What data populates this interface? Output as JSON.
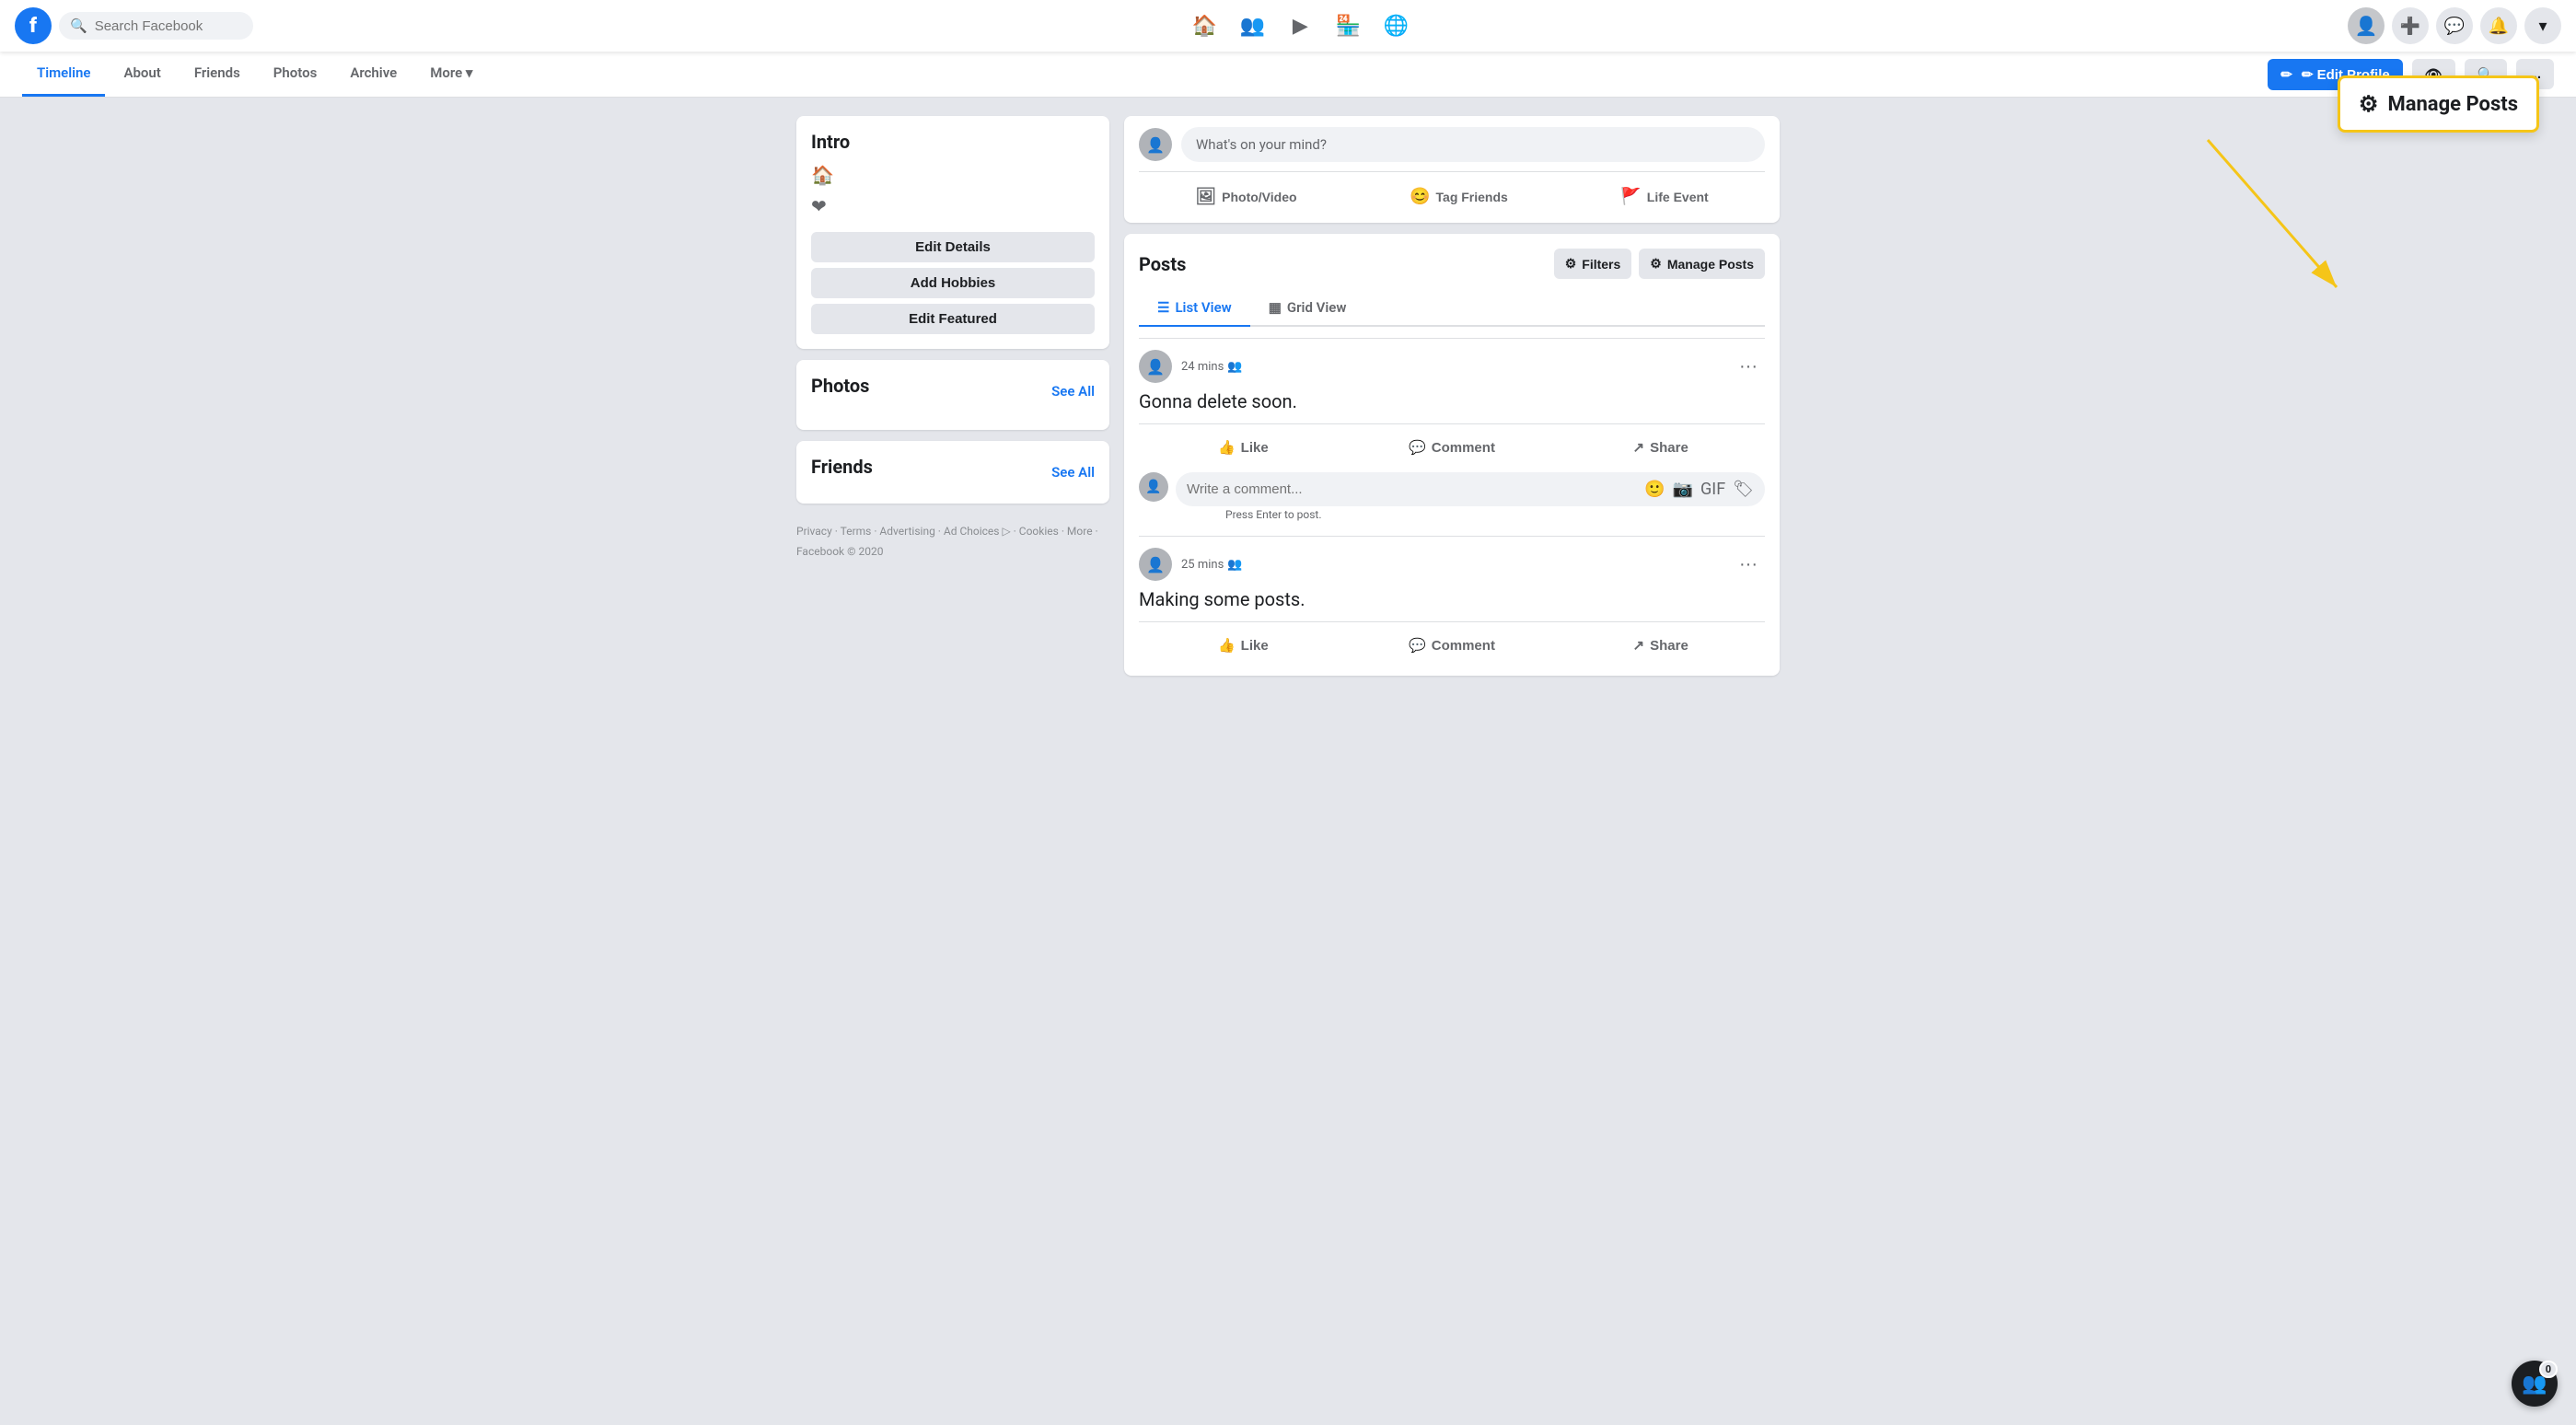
{
  "topnav": {
    "search_placeholder": "Search Facebook",
    "nav_icons": [
      "🏠",
      "👥",
      "▶",
      "🏪",
      "🌐"
    ],
    "add_label": "+",
    "messenger_label": "💬",
    "bell_label": "🔔",
    "dropdown_label": "▾"
  },
  "profile_tabs": {
    "tabs": [
      {
        "label": "Timeline",
        "active": true
      },
      {
        "label": "About",
        "active": false
      },
      {
        "label": "Friends",
        "active": false
      },
      {
        "label": "Photos",
        "active": false
      },
      {
        "label": "Archive",
        "active": false
      },
      {
        "label": "More ▾",
        "active": false
      }
    ],
    "edit_profile": "✏ Edit Profile",
    "eye_label": "👁",
    "search_label": "🔍",
    "more_label": "..."
  },
  "intro": {
    "title": "Intro",
    "home_icon": "🏠",
    "heart_icon": "❤",
    "edit_details": "Edit Details",
    "add_hobbies": "Add Hobbies",
    "edit_featured": "Edit Featured"
  },
  "photos": {
    "title": "Photos",
    "see_all": "See All"
  },
  "friends": {
    "title": "Friends",
    "see_all": "See All"
  },
  "footer": {
    "links": "Privacy · Terms · Advertising · Ad Choices ▷ · Cookies · More · Facebook © 2020"
  },
  "composer": {
    "placeholder": "What's on your mind?",
    "photo_video": "Photo/Video",
    "tag_friends": "Tag Friends",
    "life_event": "Life Event"
  },
  "posts_section": {
    "title": "Posts",
    "filters_label": "Filters",
    "manage_posts_label": "Manage Posts",
    "list_view": "List View",
    "grid_view": "Grid View",
    "posts": [
      {
        "time": "24 mins",
        "audience_icon": "👥",
        "text": "Gonna delete soon.",
        "like": "Like",
        "comment": "Comment",
        "share": "Share",
        "comment_placeholder": "Write a comment...",
        "press_enter": "Press Enter to post."
      },
      {
        "time": "25 mins",
        "audience_icon": "👥",
        "text": "Making some posts.",
        "like": "Like",
        "comment": "Comment",
        "share": "Share"
      }
    ]
  },
  "manage_posts_callout": {
    "icon": "⚙",
    "label": "Manage Posts"
  },
  "people_badge": {
    "icon": "👥",
    "count": "0"
  }
}
